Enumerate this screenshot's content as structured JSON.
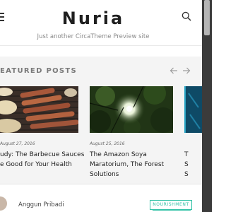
{
  "header": {
    "site_title": "Nuria",
    "tagline": "Just another CircaTheme Preview site"
  },
  "featured": {
    "heading": "EATURED POSTS",
    "cards": [
      {
        "date": "August 27, 2016",
        "title_line1": "udy: The Barbecue Sauces",
        "title_line2": "e Good for Your Health"
      },
      {
        "date": "August 25, 2016",
        "title_line1": "The Amazon Soya",
        "title_line2": "Maratorium, The Forest",
        "title_line3": "Solutions"
      },
      {
        "title_line1": "T",
        "title_line2": "S",
        "title_line3": "S"
      }
    ]
  },
  "post": {
    "author": "Anggun Pribadi",
    "category_badge": "NOURISHMENT"
  },
  "colors": {
    "accent": "#34c3a7",
    "section_background": "#f4f4f4",
    "scrollbar": "#3b3b3b"
  },
  "icons": {
    "menu": "hamburger-menu-icon",
    "search": "search-icon",
    "prev": "chevron-left-icon",
    "next": "chevron-right-icon"
  }
}
